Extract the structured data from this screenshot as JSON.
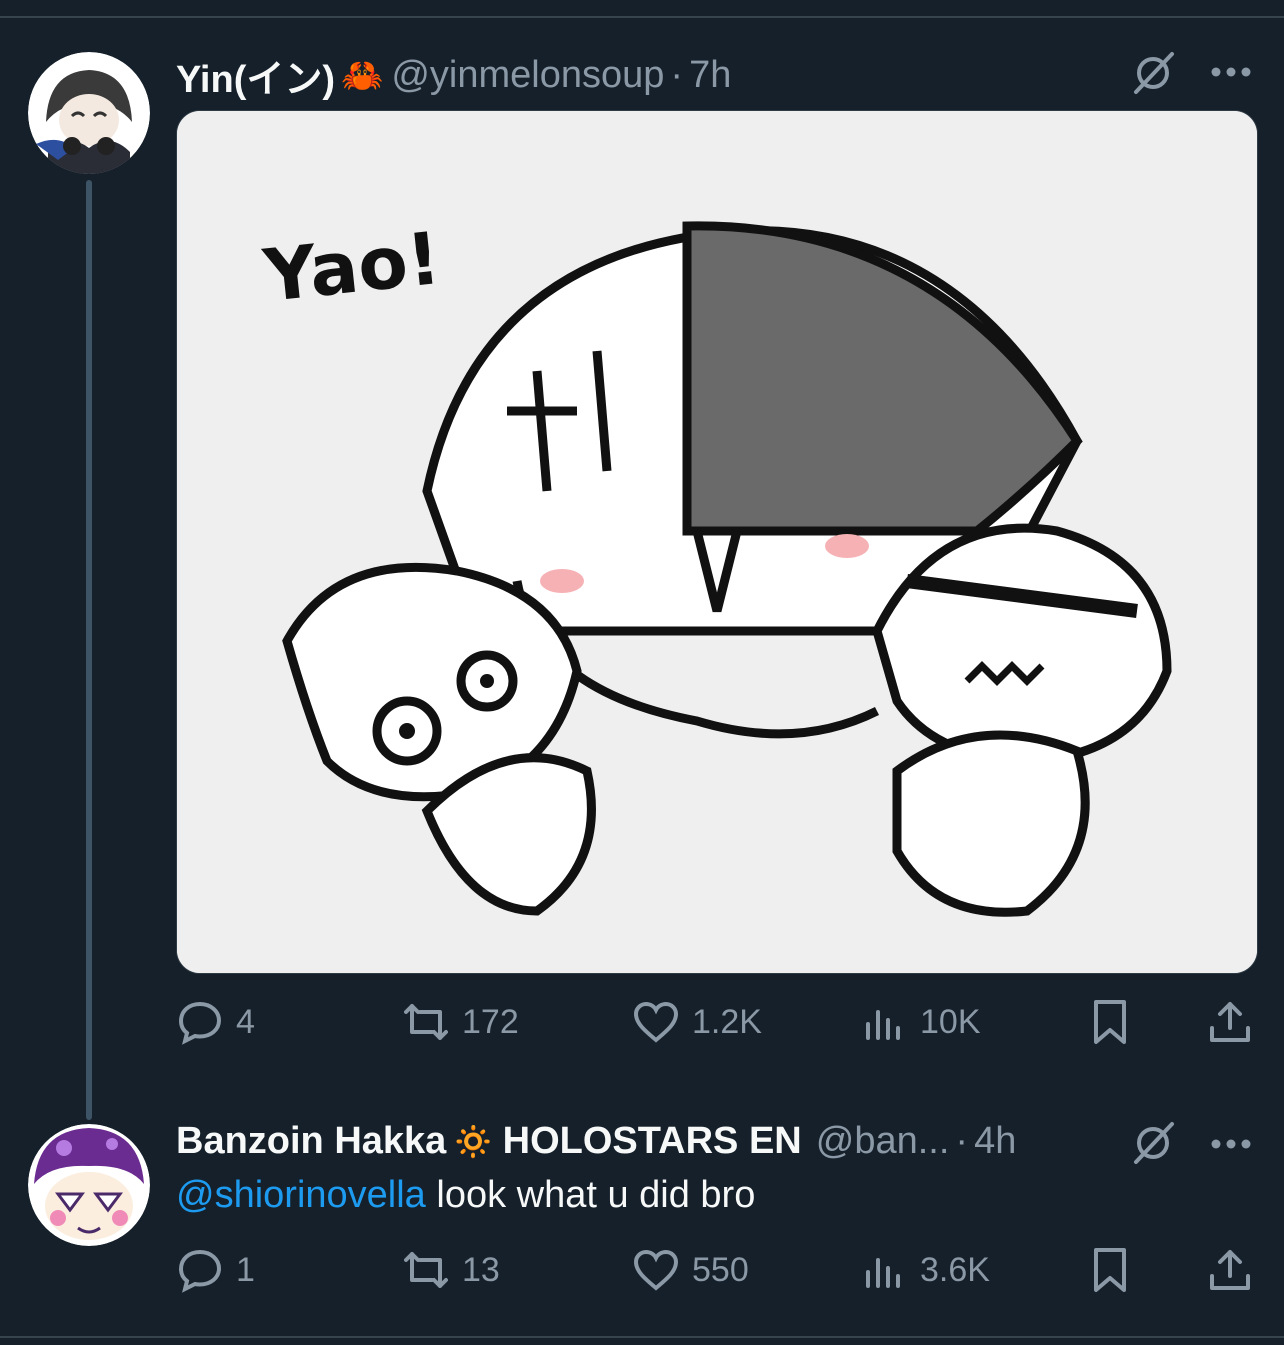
{
  "tweet": {
    "author_name": "Yin(イン)",
    "author_emoji": "🦀",
    "handle": "@yinmelonsoup",
    "separator": "·",
    "time": "7h",
    "image_text": "Yao!",
    "stats": {
      "replies": "4",
      "reposts": "172",
      "likes": "1.2K",
      "views": "10K"
    }
  },
  "reply": {
    "author_name": "Banzoin Hakka",
    "author_emoji": "🔅",
    "author_suffix": "HOLOSTARS EN",
    "handle": "@ban...",
    "separator": "·",
    "time": "4h",
    "mention": "@shiorinovella",
    "text": " look what u did bro",
    "stats": {
      "replies": "1",
      "reposts": "13",
      "likes": "550",
      "views": "3.6K"
    }
  },
  "colors": {
    "background": "#15202b",
    "text_primary": "#f7f9f9",
    "text_secondary": "#8b98a5",
    "link": "#1d9bf0",
    "thread_line": "#3d5466"
  },
  "icons": [
    "grok-icon",
    "more-icon",
    "reply-icon",
    "repost-icon",
    "like-icon",
    "views-icon",
    "bookmark-icon",
    "share-icon"
  ]
}
